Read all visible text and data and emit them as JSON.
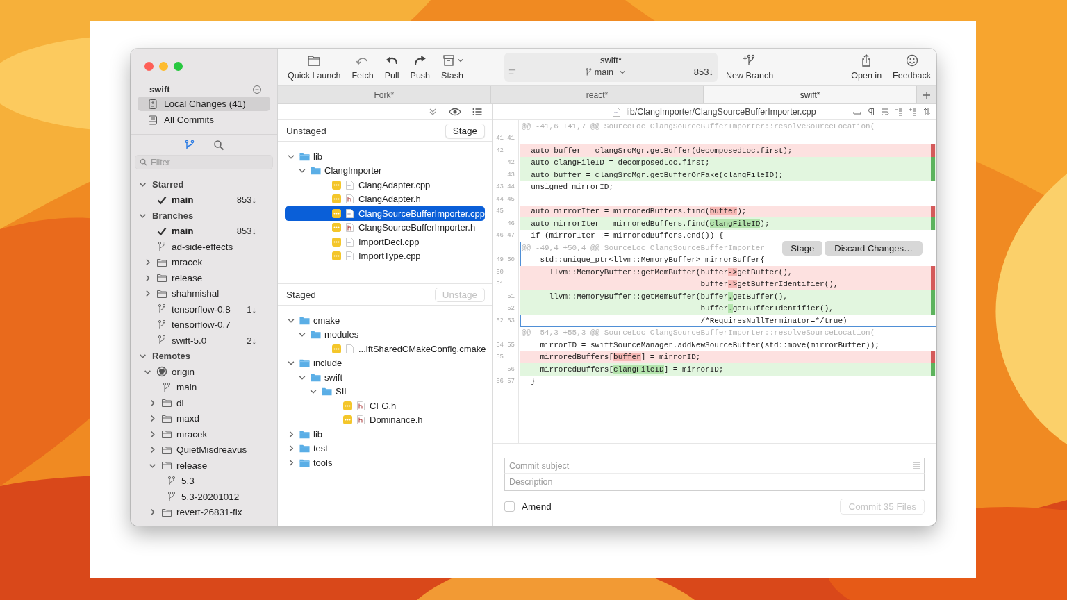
{
  "sidebar": {
    "repo": "swift",
    "nav": [
      {
        "kind": "changes",
        "label": "Local Changes (41)",
        "selected": true
      },
      {
        "kind": "commits",
        "label": "All Commits",
        "selected": false
      }
    ],
    "views": [
      {
        "kind": "branches",
        "selected": true
      },
      {
        "kind": "search",
        "selected": false
      }
    ],
    "filter": {
      "placeholder": "Filter"
    },
    "tree": [
      {
        "kind": "section",
        "label": "Starred",
        "expanded": true,
        "children": [
          {
            "kind": "current",
            "label": "main",
            "count": "853↓"
          }
        ]
      },
      {
        "kind": "section",
        "label": "Branches",
        "expanded": true,
        "children": [
          {
            "kind": "current",
            "label": "main",
            "count": "853↓"
          },
          {
            "kind": "branch",
            "label": "ad-side-effects"
          },
          {
            "kind": "folder",
            "label": "mracek",
            "expanded": false
          },
          {
            "kind": "folder",
            "label": "release",
            "expanded": false
          },
          {
            "kind": "folder",
            "label": "shahmishal",
            "expanded": false
          },
          {
            "kind": "branch",
            "label": "tensorflow-0.8",
            "count": "1↓"
          },
          {
            "kind": "branch",
            "label": "tensorflow-0.7"
          },
          {
            "kind": "branch",
            "label": "swift-5.0",
            "count": "2↓"
          }
        ]
      },
      {
        "kind": "section",
        "label": "Remotes",
        "expanded": true,
        "children": [
          {
            "kind": "remote",
            "label": "origin",
            "expanded": true,
            "children": [
              {
                "kind": "branch",
                "label": "main"
              },
              {
                "kind": "folder",
                "label": "dl",
                "expanded": false
              },
              {
                "kind": "folder",
                "label": "maxd",
                "expanded": false
              },
              {
                "kind": "folder",
                "label": "mracek",
                "expanded": false
              },
              {
                "kind": "folder",
                "label": "QuietMisdreavus",
                "expanded": false
              },
              {
                "kind": "folder",
                "label": "release",
                "expanded": true,
                "children": [
                  {
                    "kind": "branch",
                    "label": "5.3"
                  },
                  {
                    "kind": "branch",
                    "label": "5.3-20201012"
                  }
                ]
              },
              {
                "kind": "folder",
                "label": "revert-26831-fix",
                "expanded": false
              }
            ]
          }
        ]
      }
    ]
  },
  "toolbar": {
    "actions": [
      {
        "kind": "quick-launch",
        "label": "Quick Launch"
      },
      {
        "kind": "fetch",
        "label": "Fetch"
      },
      {
        "kind": "pull",
        "label": "Pull"
      },
      {
        "kind": "push",
        "label": "Push"
      },
      {
        "kind": "stash",
        "label": "Stash",
        "menu": true
      }
    ],
    "repo": {
      "title": "swift*",
      "branch": "main",
      "count": "853↓"
    },
    "after_repo": [
      {
        "kind": "new-branch",
        "label": "New Branch"
      }
    ],
    "right": [
      {
        "kind": "open-in",
        "label": "Open in"
      },
      {
        "kind": "feedback",
        "label": "Feedback"
      }
    ]
  },
  "tabs": [
    {
      "label": "Fork*",
      "selected": false
    },
    {
      "label": "react*",
      "selected": false
    },
    {
      "label": "swift*",
      "selected": true
    }
  ],
  "changes": {
    "unstaged": {
      "title": "Unstaged",
      "button": {
        "label": "Stage",
        "disabled": false
      },
      "tree": [
        {
          "kind": "folder",
          "label": "lib",
          "expanded": true,
          "children": [
            {
              "kind": "folder",
              "label": "ClangImporter",
              "expanded": true,
              "children": [
                {
                  "kind": "source",
                  "label": "ClangAdapter.cpp",
                  "selected": false
                },
                {
                  "kind": "header",
                  "label": "ClangAdapter.h",
                  "selected": false
                },
                {
                  "kind": "source",
                  "label": "ClangSourceBufferImporter.cpp",
                  "selected": true
                },
                {
                  "kind": "header",
                  "label": "ClangSourceBufferImporter.h",
                  "selected": false
                },
                {
                  "kind": "source",
                  "label": "ImportDecl.cpp",
                  "selected": false
                },
                {
                  "kind": "source",
                  "label": "ImportType.cpp",
                  "selected": false
                }
              ]
            }
          ]
        }
      ]
    },
    "staged": {
      "title": "Staged",
      "button": {
        "label": "Unstage",
        "disabled": true
      },
      "tree": [
        {
          "kind": "folder",
          "label": "cmake",
          "expanded": true,
          "children": [
            {
              "kind": "folder",
              "label": "modules",
              "expanded": true,
              "children": [
                {
                  "kind": "plain",
                  "label": "...iftSharedCMakeConfig.cmake",
                  "selected": false
                }
              ]
            }
          ]
        },
        {
          "kind": "folder",
          "label": "include",
          "expanded": true,
          "children": [
            {
              "kind": "folder",
              "label": "swift",
              "expanded": true,
              "children": [
                {
                  "kind": "folder",
                  "label": "SIL",
                  "expanded": true,
                  "children": [
                    {
                      "kind": "header",
                      "label": "CFG.h",
                      "selected": false
                    },
                    {
                      "kind": "header",
                      "label": "Dominance.h",
                      "selected": false
                    }
                  ]
                }
              ]
            }
          ]
        },
        {
          "kind": "folder",
          "label": "lib",
          "expanded": false
        },
        {
          "kind": "folder",
          "label": "test",
          "expanded": false
        },
        {
          "kind": "folder",
          "label": "tools",
          "expanded": false
        }
      ]
    }
  },
  "diff": {
    "path": "lib/ClangImporter/ClangSourceBufferImporter.cpp",
    "hunks": [
      {
        "header": "@@ -41,6 +41,7 @@ SourceLoc ClangSourceBufferImporter::resolveSourceLocation(",
        "selected": false,
        "lines": [
          {
            "kind": "context",
            "old": "41",
            "new": "41"
          },
          {
            "kind": "removed",
            "old": "42",
            "text": "  auto buffer = clangSrcMgr.getBuffer(decomposedLoc.first);"
          },
          {
            "kind": "added",
            "new": "42",
            "text": "  auto clangFileID = decomposedLoc.first;"
          },
          {
            "kind": "added",
            "new": "43",
            "text": "  auto buffer = clangSrcMgr.getBufferOrFake(clangFileID);"
          },
          {
            "kind": "context",
            "old": "43",
            "new": "44",
            "text": "  unsigned mirrorID;"
          },
          {
            "kind": "context",
            "old": "44",
            "new": "45"
          },
          {
            "kind": "removed",
            "old": "45",
            "parts": [
              {
                "text": "  auto mirrorIter = mirroredBuffers.find(",
                "changed": false
              },
              {
                "text": "buffer",
                "changed": true
              },
              {
                "text": ");",
                "changed": false
              }
            ]
          },
          {
            "kind": "added",
            "new": "46",
            "parts": [
              {
                "text": "  auto mirrorIter = mirroredBuffers.find(",
                "changed": false
              },
              {
                "text": "clangFileID",
                "changed": true
              },
              {
                "text": ");",
                "changed": false
              }
            ]
          },
          {
            "kind": "context",
            "old": "46",
            "new": "47",
            "text": "  if (mirrorIter != mirroredBuffers.end()) {"
          }
        ]
      },
      {
        "header": "@@ -49,4 +50,4 @@ SourceLoc ClangSourceBufferImporter",
        "selected": true,
        "actions": [
          {
            "label": "Stage"
          },
          {
            "label": "Discard Changes…"
          }
        ],
        "lines": [
          {
            "kind": "context",
            "old": "49",
            "new": "50",
            "text": "    std::unique_ptr<llvm::MemoryBuffer> mirrorBuffer{"
          },
          {
            "kind": "removed",
            "old": "50",
            "parts": [
              {
                "text": "      llvm::MemoryBuffer::getMemBuffer(buffer",
                "changed": false
              },
              {
                "text": "->",
                "changed": true
              },
              {
                "text": "getBuffer(),",
                "changed": false
              }
            ]
          },
          {
            "kind": "removed",
            "old": "51",
            "parts": [
              {
                "text": "                                       buffer",
                "changed": false
              },
              {
                "text": "->",
                "changed": true
              },
              {
                "text": "getBufferIdentifier(),",
                "changed": false
              }
            ]
          },
          {
            "kind": "added",
            "new": "51",
            "parts": [
              {
                "text": "      llvm::MemoryBuffer::getMemBuffer(buffer",
                "changed": false
              },
              {
                "text": ".",
                "changed": true
              },
              {
                "text": "getBuffer(),",
                "changed": false
              }
            ]
          },
          {
            "kind": "added",
            "new": "52",
            "parts": [
              {
                "text": "                                       buffer",
                "changed": false
              },
              {
                "text": ".",
                "changed": true
              },
              {
                "text": "getBufferIdentifier(),",
                "changed": false
              }
            ]
          },
          {
            "kind": "context",
            "old": "52",
            "new": "53",
            "text": "                                       /*RequiresNullTerminator=*/true)"
          }
        ]
      },
      {
        "header": "@@ -54,3 +55,3 @@ SourceLoc ClangSourceBufferImporter::resolveSourceLocation(",
        "selected": false,
        "lines": [
          {
            "kind": "context",
            "old": "54",
            "new": "55",
            "text": "    mirrorID = swiftSourceManager.addNewSourceBuffer(std::move(mirrorBuffer));"
          },
          {
            "kind": "removed",
            "old": "55",
            "parts": [
              {
                "text": "    mirroredBuffers[",
                "changed": false
              },
              {
                "text": "buffer",
                "changed": true
              },
              {
                "text": "] = mirrorID;",
                "changed": false
              }
            ]
          },
          {
            "kind": "added",
            "new": "56",
            "parts": [
              {
                "text": "    mirroredBuffers[",
                "changed": false
              },
              {
                "text": "clangFileID",
                "changed": true
              },
              {
                "text": "] = mirrorID;",
                "changed": false
              }
            ]
          },
          {
            "kind": "context",
            "old": "56",
            "new": "57",
            "text": "  }"
          }
        ]
      }
    ]
  },
  "commit": {
    "subject": {
      "placeholder": "Commit subject"
    },
    "description": {
      "placeholder": "Description"
    },
    "amend": {
      "label": "Amend",
      "checked": false
    },
    "button": {
      "label": "Commit 35 Files",
      "disabled": true
    }
  }
}
